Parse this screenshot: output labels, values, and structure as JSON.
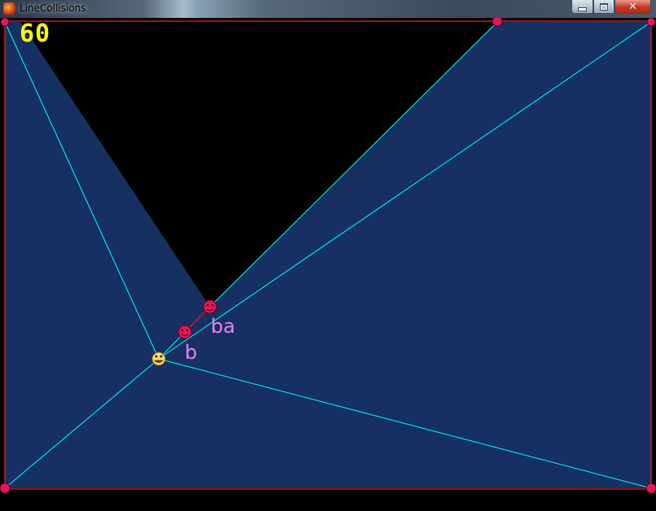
{
  "window": {
    "title": "LineCollisions",
    "app_icon": "game-app-icon",
    "buttons": {
      "minimize_icon": "minimize-icon",
      "maximize_icon": "maximize-icon",
      "close_label": "✕"
    }
  },
  "hud": {
    "fps": "60",
    "fps_color": "#ffff00"
  },
  "scene": {
    "label_color": "#f080f0",
    "labels": {
      "ba": "ba",
      "b": "b"
    },
    "colors": {
      "background": "#000000",
      "lit_region": "#163061",
      "ray": "#00ffff",
      "wall": "#ff2020",
      "segment": "#c01030",
      "marker": "#e0185a",
      "viewer": "#ffe070"
    },
    "markers": [
      "corner-marker-top-left",
      "corner-marker-top-right",
      "corner-marker-bottom-left",
      "corner-marker-bottom-right",
      "marker-top-edge",
      "obstacle-endpoint-ba",
      "obstacle-endpoint-b",
      "viewer-face"
    ]
  }
}
